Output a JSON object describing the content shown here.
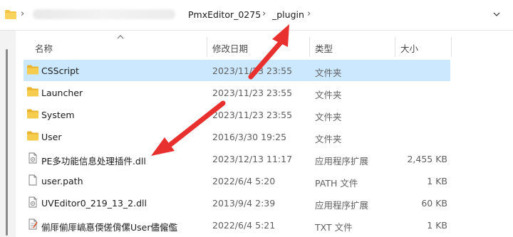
{
  "address_bar": {
    "crumbs": [
      "PmxEditor_0275",
      "_plugin"
    ],
    "separator": "›"
  },
  "columns": {
    "name": "名称",
    "date": "修改日期",
    "type": "类型",
    "size": "大小"
  },
  "files": [
    {
      "name": "CSScript",
      "date": "2023/11/23 23:55",
      "type": "文件夹",
      "size": "",
      "icon": "folder-icon",
      "selected": true
    },
    {
      "name": "Launcher",
      "date": "2023/11/23 23:55",
      "type": "文件夹",
      "size": "",
      "icon": "folder-icon"
    },
    {
      "name": "System",
      "date": "2023/11/23 23:55",
      "type": "文件夹",
      "size": "",
      "icon": "folder-icon"
    },
    {
      "name": "User",
      "date": "2016/3/30 19:25",
      "type": "文件夹",
      "size": "",
      "icon": "folder-icon"
    },
    {
      "name": "PE多功能信息处理插件.dll",
      "date": "2023/12/13 11:17",
      "type": "应用程序扩展",
      "size": "2,455 KB",
      "icon": "dll-file-icon"
    },
    {
      "name": "user.path",
      "date": "2022/6/4 5:20",
      "type": "PATH 文件",
      "size": "1 KB",
      "icon": "blank-file-icon"
    },
    {
      "name": "UVEditor0_219_13_2.dll",
      "date": "2013/9/4 2:39",
      "type": "应用程序扩展",
      "size": "60 KB",
      "icon": "dll-file-icon"
    },
    {
      "name": "偂厞偂厞嵪惪偄傞偝傫User儘僱儖",
      "date": "2022/6/4 5:21",
      "type": "TXT 文件",
      "size": "1 KB",
      "icon": "text-file-icon"
    }
  ],
  "annotation_color": "#e8312e",
  "selection_color": "#cce8ff",
  "folder_color": "#f4c543"
}
